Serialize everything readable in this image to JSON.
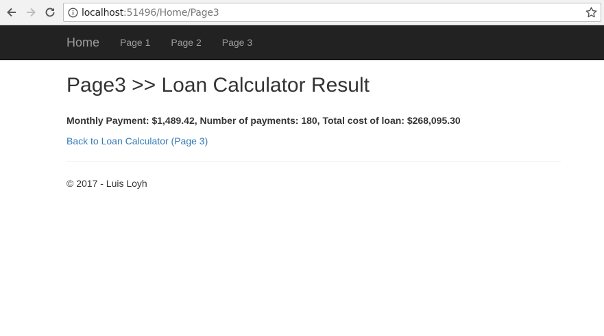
{
  "browser": {
    "url_host": "localhost",
    "url_path": ":51496/Home/Page3"
  },
  "navbar": {
    "brand": "Home",
    "links": [
      "Page 1",
      "Page 2",
      "Page 3"
    ]
  },
  "main": {
    "title": "Page3 >> Loan Calculator Result",
    "result": "Monthly Payment: $1,489.42, Number of payments: 180, Total cost of loan: $268,095.30",
    "back_link": "Back to Loan Calculator (Page 3)"
  },
  "footer": {
    "text": "© 2017 - Luis Loyh"
  },
  "colors": {
    "navbar_bg": "#222222",
    "nav_text": "#9d9d9d",
    "link": "#337ab7"
  }
}
